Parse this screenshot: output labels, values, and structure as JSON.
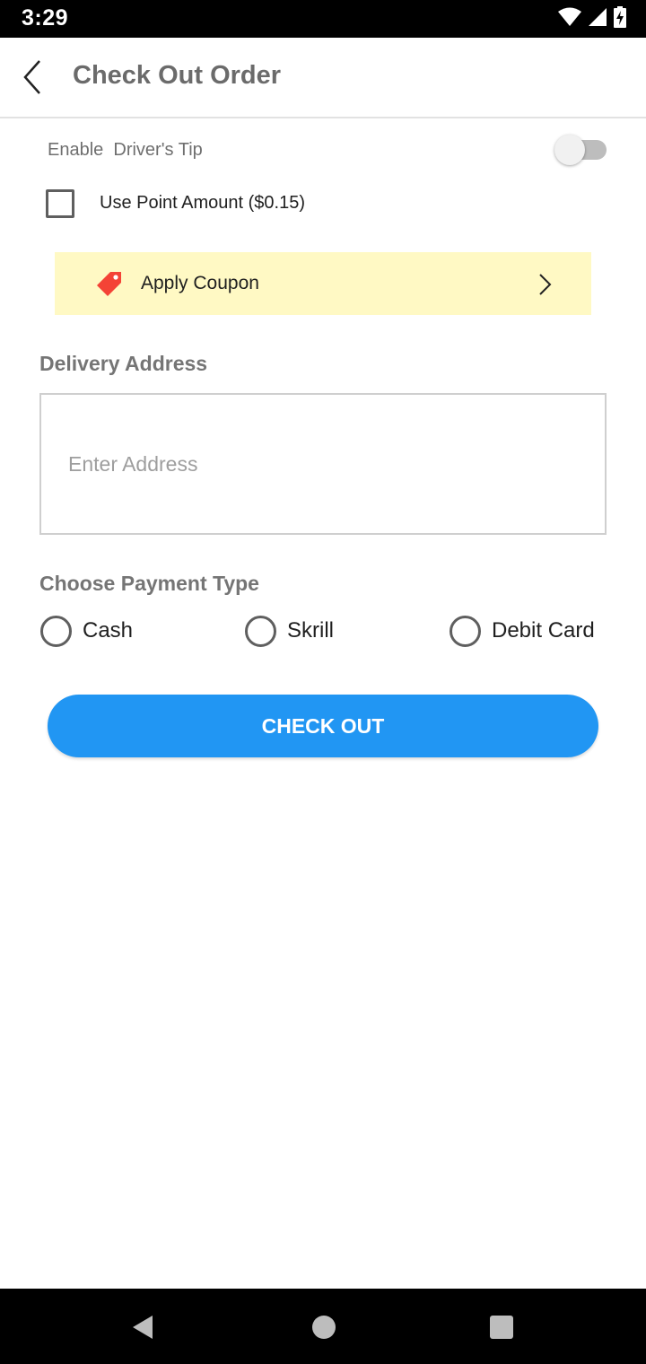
{
  "status_bar": {
    "time": "3:29",
    "icons": [
      "wifi-icon",
      "cellular-signal-icon",
      "battery-charging-icon"
    ]
  },
  "app_bar": {
    "title": "Check Out Order",
    "back_icon": "chevron-left-icon"
  },
  "tip": {
    "label": "Enable  Driver's Tip",
    "enabled": false
  },
  "points": {
    "label": "Use Point Amount ($0.15)",
    "checked": false
  },
  "coupon": {
    "label": "Apply Coupon",
    "icon": "price-tag-icon",
    "chevron": "chevron-right-icon",
    "background": "#fff9c4",
    "tag_color": "#f44336"
  },
  "delivery": {
    "title": "Delivery Address",
    "placeholder": "Enter Address",
    "value": ""
  },
  "payment": {
    "title": "Choose Payment Type",
    "options": [
      {
        "label": "Cash",
        "selected": false
      },
      {
        "label": "Skrill",
        "selected": false
      },
      {
        "label": "Debit Card",
        "selected": false
      }
    ]
  },
  "checkout": {
    "label": "CHECK OUT",
    "color": "#2196f3"
  },
  "nav_bar": {
    "icons": [
      "back-triangle-icon",
      "home-circle-icon",
      "recents-square-icon"
    ]
  }
}
